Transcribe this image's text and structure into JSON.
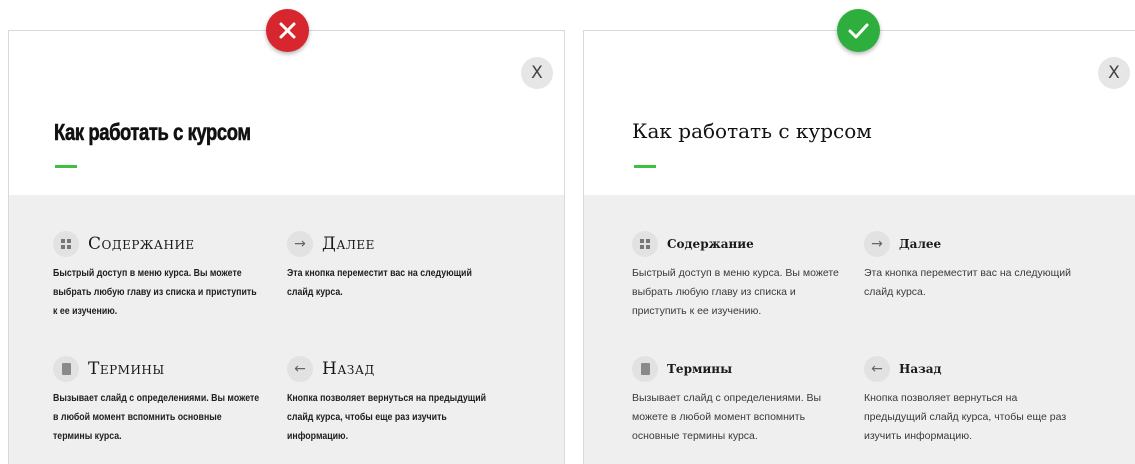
{
  "colors": {
    "bad_badge": "#d7262e",
    "good_badge": "#2eae3d",
    "accent_bar": "#3fbf3f",
    "panel_gray": "#efefef"
  },
  "bad": {
    "badge_icon": "x-icon",
    "close_label": "X",
    "title": "Как работать с курсом",
    "items": [
      {
        "icon": "grid-icon",
        "title": "Содержание",
        "desc": "Быстрый доступ в меню курса. Вы можете выбрать любую главу из списка и приступить к ее изучению."
      },
      {
        "icon": "arrow-right-icon",
        "title": "Далее",
        "desc": "Эта кнопка переместит вас на следующий слайд курса."
      },
      {
        "icon": "book-icon",
        "title": "Термины",
        "desc": "Вызывает слайд с определениями. Вы можете в любой момент вспомнить основные термины курса."
      },
      {
        "icon": "arrow-left-icon",
        "title": "Назад",
        "desc": "Кнопка позволяет вернуться на предыдущий слайд курса, чтобы еще раз изучить информацию."
      }
    ]
  },
  "good": {
    "badge_icon": "check-icon",
    "close_label": "X",
    "title": "Как работать с курсом",
    "items": [
      {
        "icon": "grid-icon",
        "title": "Содержание",
        "desc": "Быстрый доступ в меню курса. Вы можете выбрать любую главу из списка и приступить к ее изучению."
      },
      {
        "icon": "arrow-right-icon",
        "title": "Далее",
        "desc": "Эта кнопка переместит вас на следующий слайд курса."
      },
      {
        "icon": "book-icon",
        "title": "Термины",
        "desc": "Вызывает слайд с определениями. Вы можете в любой момент вспомнить основные термины курса."
      },
      {
        "icon": "arrow-left-icon",
        "title": "Назад",
        "desc": "Кнопка позволяет вернуться на предыдущий слайд курса, чтобы еще раз изучить информацию."
      }
    ]
  }
}
